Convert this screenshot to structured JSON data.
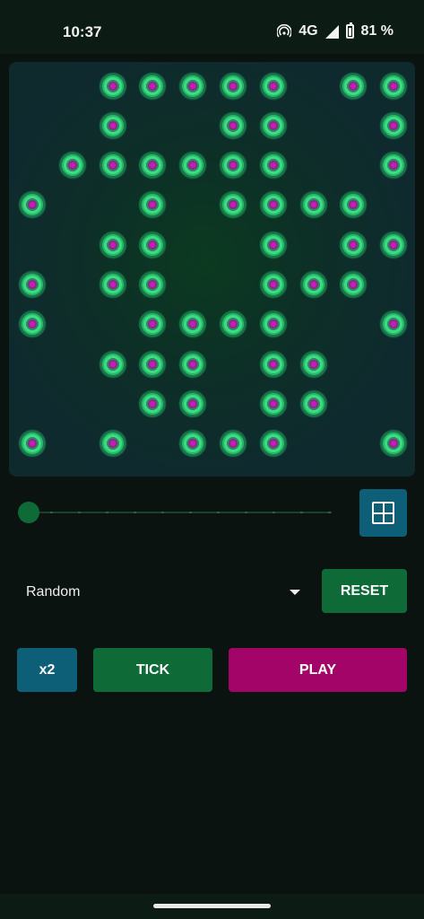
{
  "status_bar": {
    "time": "10:37",
    "network": "4G",
    "battery": "81 %",
    "icons": [
      "hotspot-icon",
      "signal-icon",
      "battery-icon"
    ]
  },
  "board": {
    "rows": 10,
    "cols": 10,
    "live_cells": [
      [
        0,
        2
      ],
      [
        0,
        3
      ],
      [
        0,
        4
      ],
      [
        0,
        5
      ],
      [
        0,
        6
      ],
      [
        0,
        8
      ],
      [
        0,
        9
      ],
      [
        1,
        2
      ],
      [
        1,
        5
      ],
      [
        1,
        6
      ],
      [
        1,
        9
      ],
      [
        2,
        1
      ],
      [
        2,
        2
      ],
      [
        2,
        3
      ],
      [
        2,
        4
      ],
      [
        2,
        5
      ],
      [
        2,
        6
      ],
      [
        2,
        9
      ],
      [
        3,
        0
      ],
      [
        3,
        3
      ],
      [
        3,
        5
      ],
      [
        3,
        6
      ],
      [
        3,
        7
      ],
      [
        3,
        8
      ],
      [
        4,
        2
      ],
      [
        4,
        3
      ],
      [
        4,
        6
      ],
      [
        4,
        8
      ],
      [
        4,
        9
      ],
      [
        5,
        0
      ],
      [
        5,
        2
      ],
      [
        5,
        3
      ],
      [
        5,
        6
      ],
      [
        5,
        7
      ],
      [
        5,
        8
      ],
      [
        6,
        0
      ],
      [
        6,
        3
      ],
      [
        6,
        4
      ],
      [
        6,
        5
      ],
      [
        6,
        6
      ],
      [
        6,
        9
      ],
      [
        7,
        2
      ],
      [
        7,
        3
      ],
      [
        7,
        4
      ],
      [
        7,
        6
      ],
      [
        7,
        7
      ],
      [
        8,
        3
      ],
      [
        8,
        4
      ],
      [
        8,
        6
      ],
      [
        8,
        7
      ],
      [
        9,
        0
      ],
      [
        9,
        2
      ],
      [
        9,
        4
      ],
      [
        9,
        5
      ],
      [
        9,
        6
      ],
      [
        9,
        9
      ]
    ],
    "colors": {
      "cell_core": "#c81ac3",
      "cell_glow": "#3ddc82",
      "board_bg": "#0f2a2e"
    }
  },
  "speed_slider": {
    "value": 0,
    "ticks": 11
  },
  "grid_toggle": {
    "icon": "grid-icon"
  },
  "pattern_select": {
    "value": "Random",
    "icon": "dropdown-icon"
  },
  "buttons": {
    "reset": "RESET",
    "speed": "x2",
    "tick": "TICK",
    "play": "PLAY"
  },
  "colors": {
    "green": "#0e6b37",
    "teal": "#0d5f78",
    "magenta": "#a20468",
    "background": "#0a130f"
  }
}
